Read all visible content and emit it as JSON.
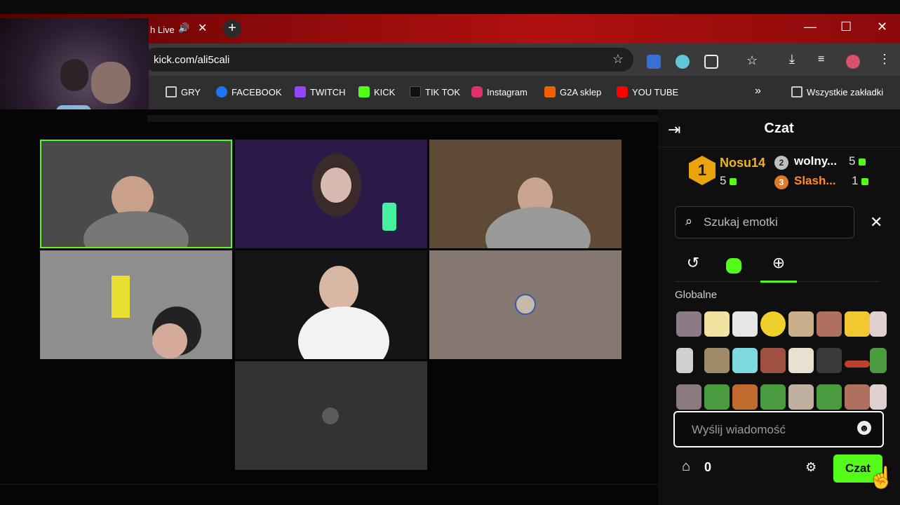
{
  "browser": {
    "tab_title": "h Live",
    "url": "kick.com/ali5cali",
    "bookmarks": [
      {
        "label": "GRY",
        "icon": "folder-icon",
        "color": "#cccccc"
      },
      {
        "label": "FACEBOOK",
        "icon": "facebook-icon",
        "color": "#1877f2"
      },
      {
        "label": "TWITCH",
        "icon": "twitch-icon",
        "color": "#9146ff"
      },
      {
        "label": "KICK",
        "icon": "kick-icon",
        "color": "#53fc18"
      },
      {
        "label": "TIK TOK",
        "icon": "tiktok-icon",
        "color": "#ffffff"
      },
      {
        "label": "Instagram",
        "icon": "instagram-icon",
        "color": "#e1306c"
      },
      {
        "label": "G2A sklep",
        "icon": "g2a-icon",
        "color": "#f05f00"
      },
      {
        "label": "YOU TUBE",
        "icon": "youtube-icon",
        "color": "#ff0000"
      }
    ],
    "all_bookmarks_label": "Wszystkie zakładki"
  },
  "chat": {
    "title": "Czat",
    "leaderboard": [
      {
        "rank": "1",
        "name": "Nosu14",
        "count": "5",
        "color": "#f5b21a"
      },
      {
        "rank": "2",
        "name": "wolny...",
        "count": "5",
        "color": "#ffffff"
      },
      {
        "rank": "3",
        "name": "Slash...",
        "count": "1",
        "color": "#ff8a2a"
      }
    ],
    "emote_search_placeholder": "Szukaj emotki",
    "section_label": "Globalne",
    "message_placeholder": "Wyślij wiadomość",
    "points": "0",
    "send_label": "Czat"
  },
  "colors": {
    "accent": "#53fc18",
    "gold": "#e9a40b"
  }
}
